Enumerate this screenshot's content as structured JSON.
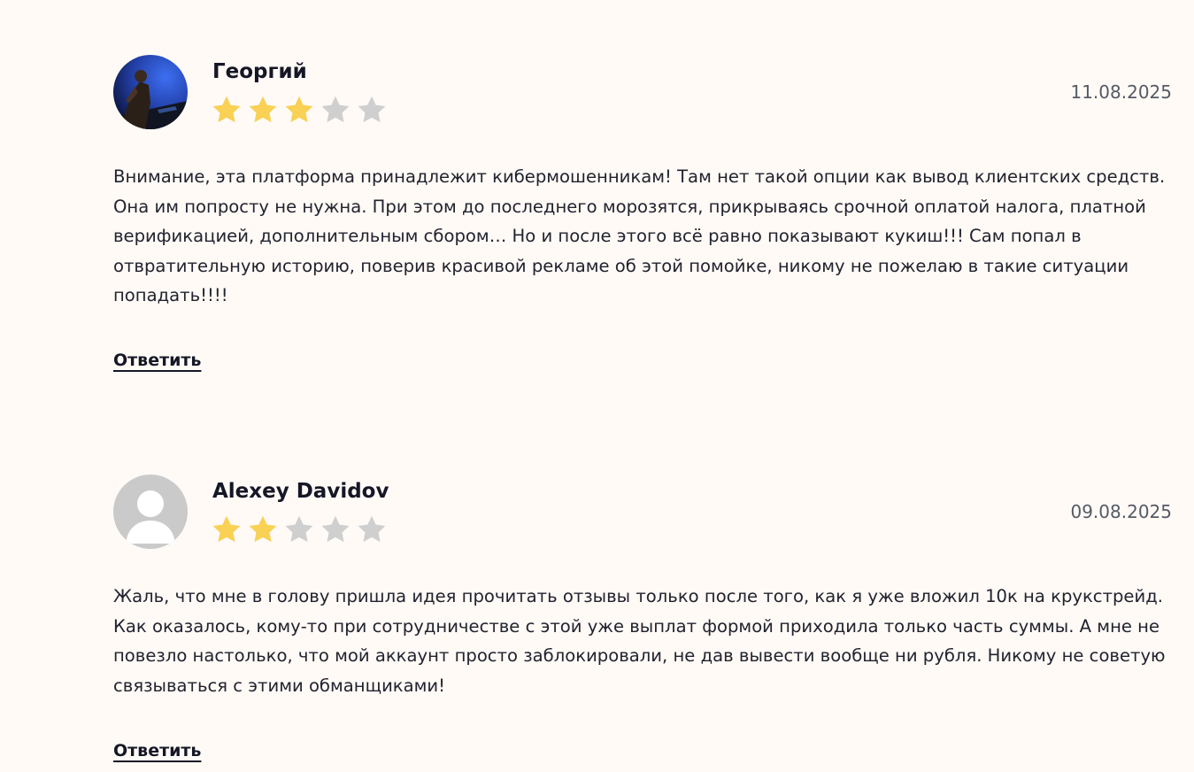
{
  "reviews": [
    {
      "author": "Георгий",
      "rating": 3,
      "max_rating": 5,
      "date": "11.08.2025",
      "avatar": "photo-avatar",
      "text": "Внимание, эта платформа принадлежит кибермошенникам! Там нет такой опции как вывод клиентских средств. Она им попросту не нужна. При этом до последнего морозятся, прикрываясь срочной оплатой налога, платной верификацией, дополнительным сбором… Но и после этого всё равно показывают кукиш!!! Сам попал в отвратительную историю, поверив красивой рекламе об этой помойке, никому не пожелаю в такие ситуации попадать!!!!",
      "reply_label": "Ответить"
    },
    {
      "author": "Alexey Davidov",
      "rating": 2,
      "max_rating": 5,
      "date": "09.08.2025",
      "avatar": "default-user-avatar",
      "text": "Жаль, что мне в голову пришла идея прочитать отзывы только после того, как я уже вложил 10к на крукстрейд. Как оказалось, кому-то при сотрудничестве с этой уже выплат формой приходила только часть суммы. А мне не повезло настолько, что мой аккаунт просто заблокировали, не дав вывести вообще ни рубля. Никому не советую связываться с этими обманщиками!",
      "reply_label": "Ответить"
    }
  ],
  "colors": {
    "background": "#fffaf6",
    "star_filled": "#f8d155",
    "star_empty": "#cfcfcf",
    "text": "#22232f"
  }
}
